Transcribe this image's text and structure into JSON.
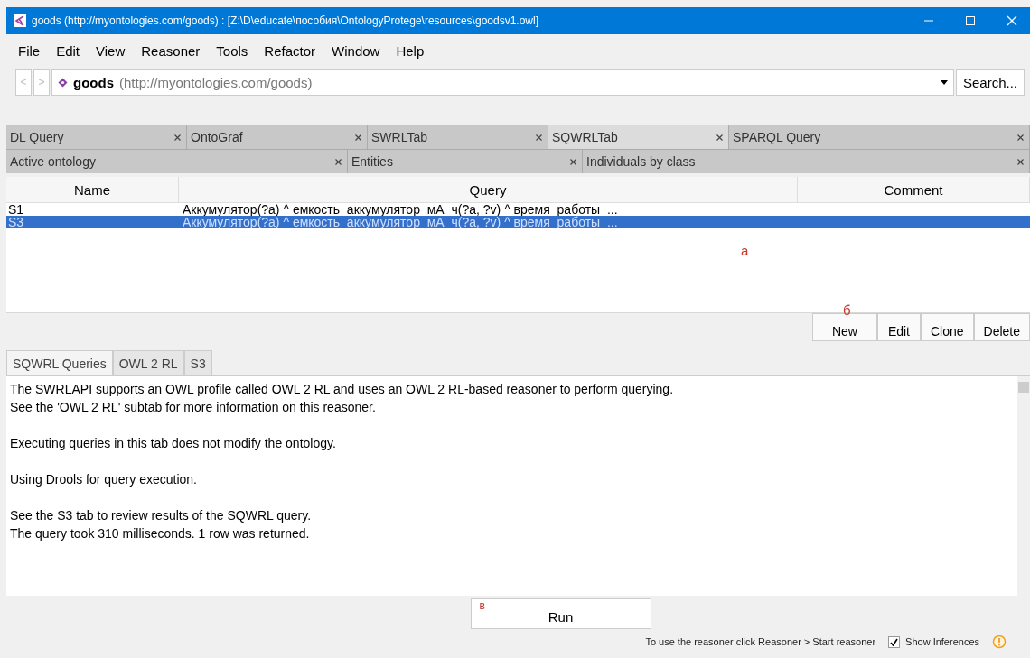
{
  "window": {
    "title": "goods (http://myontologies.com/goods)  : [Z:\\D\\educate\\пособия\\OntologyProtege\\resources\\goodsv1.owl]"
  },
  "menu": [
    "File",
    "Edit",
    "View",
    "Reasoner",
    "Tools",
    "Refactor",
    "Window",
    "Help"
  ],
  "nav": {
    "back": "<",
    "forward": ">",
    "ontology_name": "goods",
    "ontology_iri": "(http://myontologies.com/goods)",
    "search_button": "Search..."
  },
  "tab_rows": [
    [
      {
        "label": "DL Query",
        "selected": false
      },
      {
        "label": "OntoGraf",
        "selected": false
      },
      {
        "label": "SWRLTab",
        "selected": false
      },
      {
        "label": "SQWRLTab",
        "selected": true
      },
      {
        "label": "SPARQL Query",
        "selected": false
      }
    ],
    [
      {
        "label": "Active ontology",
        "selected": false
      },
      {
        "label": "Entities",
        "selected": false
      },
      {
        "label": "Individuals by class",
        "selected": false
      }
    ]
  ],
  "table": {
    "columns": [
      "Name",
      "Query",
      "Comment"
    ],
    "rows": [
      {
        "name": "S1",
        "query": "Аккумулятор(?a) ^ емкость_аккумулятор_мА_ч(?a, ?v) ^ время_работы_...",
        "selected": false
      },
      {
        "name": "S3",
        "query": "Аккумулятор(?a) ^ емкость_аккумулятор_мА_ч(?a, ?v) ^ время_работы_...",
        "selected": true
      }
    ]
  },
  "annotations": {
    "a": "а",
    "b": "б",
    "c": "в"
  },
  "buttons": [
    "New",
    "Edit",
    "Clone",
    "Delete"
  ],
  "subtabs": [
    {
      "label": "SQWRL Queries",
      "selected": true
    },
    {
      "label": "OWL 2 RL",
      "selected": false
    },
    {
      "label": "S3",
      "selected": false
    }
  ],
  "paragraphs": [
    [
      "The SWRLAPI supports an OWL profile called OWL 2 RL and uses an OWL 2 RL-based reasoner to perform querying.",
      "See the 'OWL 2 RL' subtab for more information on this reasoner."
    ],
    [
      "Executing queries in this tab does not modify the ontology."
    ],
    [
      "Using Drools for query execution."
    ],
    [
      "See the S3 tab to review results of the SQWRL query.",
      "The query took 310 milliseconds. 1 row was returned."
    ]
  ],
  "run_button": "Run",
  "status": {
    "hint": "To use the reasoner click Reasoner > Start reasoner",
    "show_inferences": {
      "label": "Show Inferences",
      "checked": true
    }
  }
}
